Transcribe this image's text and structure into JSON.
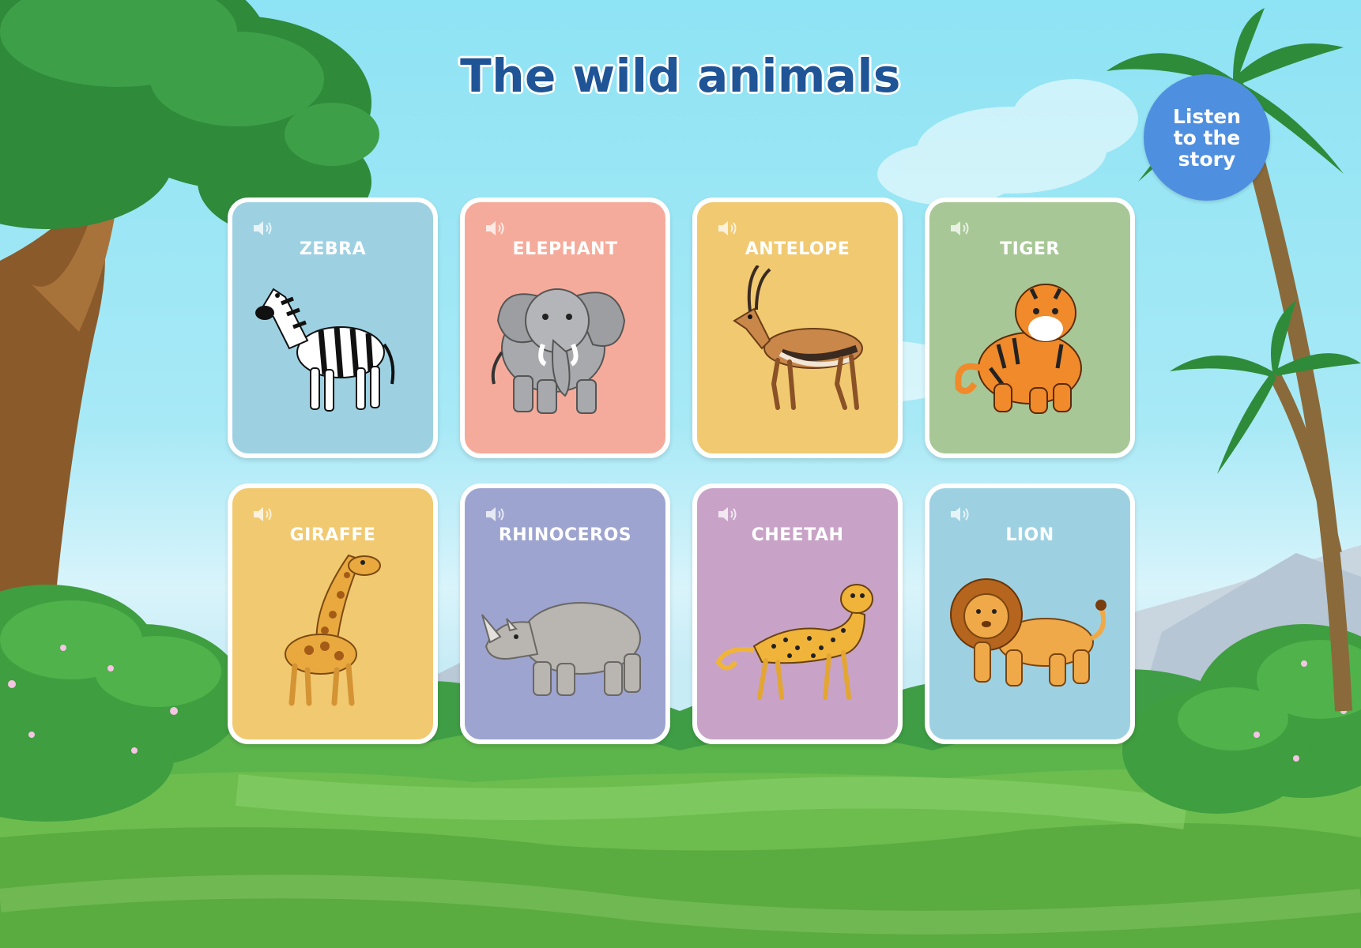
{
  "page": {
    "title": "The wild animals",
    "listen_button": "Listen\nto the\nstory"
  },
  "cards": [
    {
      "label": "ZEBRA",
      "color": "#9dd1e2",
      "animal": "zebra-icon"
    },
    {
      "label": "ELEPHANT",
      "color": "#f5ab9b",
      "animal": "elephant-icon"
    },
    {
      "label": "ANTELOPE",
      "color": "#f1c971",
      "animal": "antelope-icon"
    },
    {
      "label": "TIGER",
      "color": "#a8c796",
      "animal": "tiger-icon"
    },
    {
      "label": "GIRAFFE",
      "color": "#f1c971",
      "animal": "giraffe-icon"
    },
    {
      "label": "RHINOCEROS",
      "color": "#9da4d0",
      "animal": "rhinoceros-icon"
    },
    {
      "label": "CHEETAH",
      "color": "#c8a3c7",
      "animal": "cheetah-icon"
    },
    {
      "label": "LION",
      "color": "#9dd1e2",
      "animal": "lion-icon"
    }
  ],
  "icons": {
    "speaker": "speaker-icon"
  }
}
